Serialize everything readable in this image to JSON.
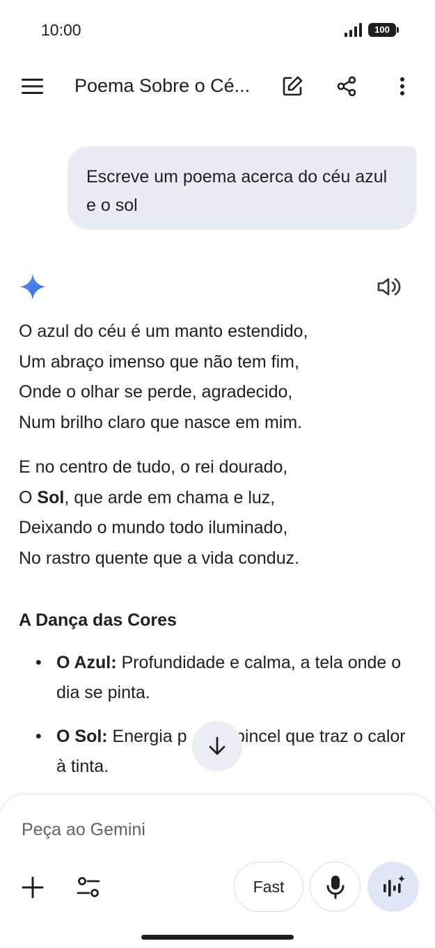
{
  "status_bar": {
    "time": "10:00",
    "battery": "100",
    "icons": [
      "signal-icon",
      "battery-icon"
    ]
  },
  "top_bar": {
    "title": "Poema Sobre o Cé...",
    "icons": [
      "menu-icon",
      "edit-icon",
      "share-icon",
      "more-vert-icon"
    ]
  },
  "user_message": {
    "text": "Escreve um poema acerca do céu azul e o sol"
  },
  "response": {
    "icons": [
      "gemini-sparkle-icon",
      "speaker-icon"
    ],
    "stanza1": [
      "O azul do céu é um manto estendido,",
      "Um abraço imenso que não tem fim,",
      "Onde o olhar se perde, agradecido,",
      "Num brilho claro que nasce em mim."
    ],
    "stanza2": {
      "line1": "E no centro de tudo, o rei dourado,",
      "line2_prefix": "O ",
      "line2_bold": "Sol",
      "line2_suffix": ", que arde em chama e luz,",
      "line3": "Deixando o mundo todo iluminado,",
      "line4": "No rastro quente que a vida conduz."
    },
    "section_heading": "A Dança das Cores",
    "bullets": [
      {
        "label": "O Azul:",
        "text": " Profundidade e calma, a tela onde o dia se pinta."
      },
      {
        "label": "O Sol:",
        "text": " Energia p          pincel que traz o calor à tinta."
      }
    ]
  },
  "input": {
    "placeholder": "Peça ao Gemini",
    "fast_label": "Fast",
    "icons": [
      "plus-icon",
      "tools-icon",
      "mic-icon",
      "live-icon",
      "arrow-down-icon"
    ]
  },
  "colors": {
    "user_bubble": "#e8ecf5",
    "gemini_blue": "#4285f4",
    "live_button": "#dfe6f6"
  }
}
